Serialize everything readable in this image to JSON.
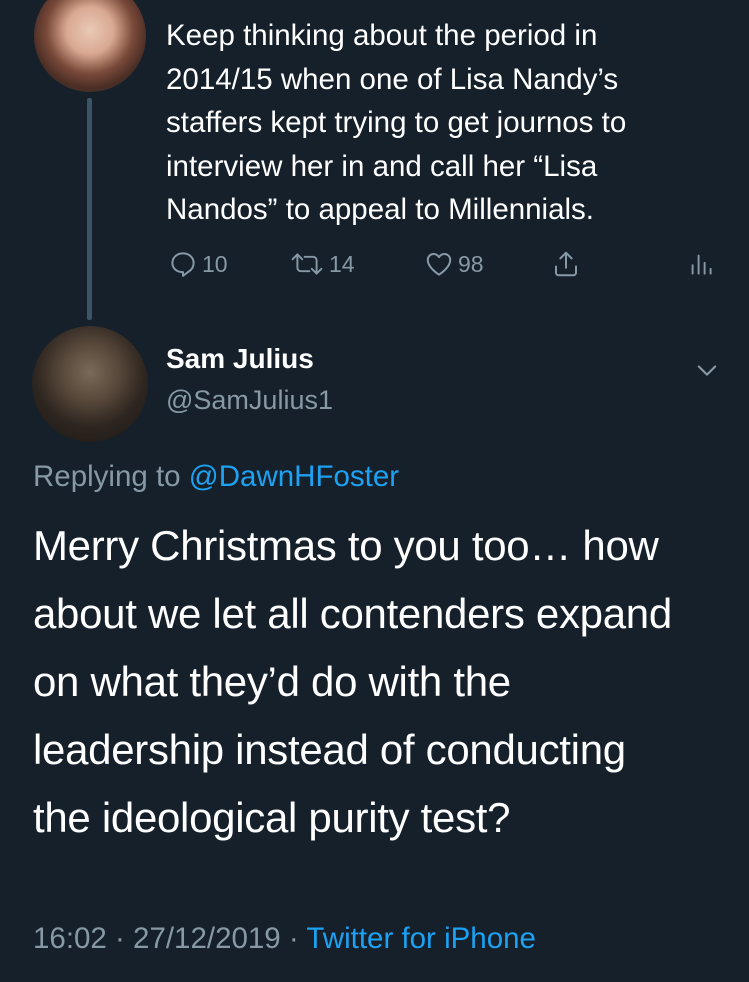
{
  "parent_tweet": {
    "text": "Keep thinking about the period in\n2014/15 when one of Lisa Nandy’s\nstaffers kept trying to get journos to\ninterview her in and call her “Lisa\nNandos” to appeal to Millennials.",
    "replies": "10",
    "retweets": "14",
    "likes": "98"
  },
  "tweet": {
    "author_name": "Sam Julius",
    "author_handle": "@SamJulius1",
    "replying_to_label": "Replying to ",
    "replying_to_handle": "@DawnHFoster",
    "text": "Merry Christmas to you too… how\nabout we let all contenders expand\non what they’d do with the\nleadership instead of conducting\nthe ideological purity test?",
    "time": "16:02",
    "separator": " · ",
    "date": "27/12/2019",
    "source": "Twitter for iPhone"
  },
  "icons": {
    "reply": "reply-icon",
    "retweet": "retweet-icon",
    "like": "heart-icon",
    "share": "share-icon",
    "analytics": "analytics-icon",
    "more": "chevron-down-icon"
  },
  "colors": {
    "background": "#15202b",
    "text": "#ffffff",
    "secondary": "#8899a6",
    "link": "#1da1f2",
    "thread_line": "#3d5466"
  }
}
